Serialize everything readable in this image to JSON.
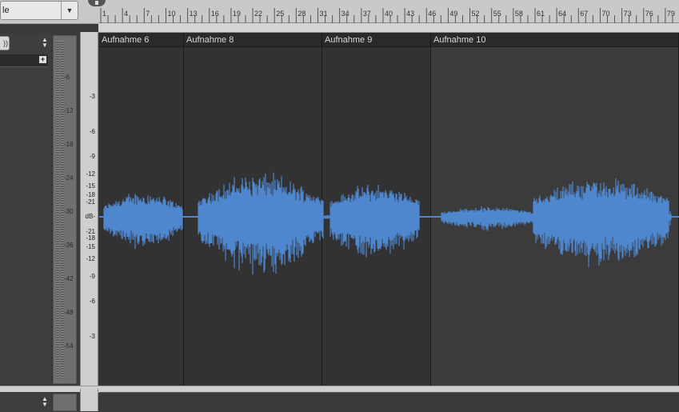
{
  "toolbar": {
    "mode_select_value": "le"
  },
  "ruler": {
    "bars": [
      "1",
      "4",
      "7",
      "10",
      "13",
      "16",
      "19",
      "22",
      "25",
      "28",
      "31",
      "34",
      "37",
      "40",
      "43",
      "46",
      "49",
      "52",
      "55",
      "58",
      "61",
      "64",
      "67",
      "70",
      "73",
      "76",
      "79",
      "8"
    ]
  },
  "meter": {
    "scale": [
      "-6",
      "-12",
      "-18",
      "-24",
      "-30",
      "-36",
      "-42",
      "-48",
      "-54"
    ]
  },
  "db_scale": {
    "labels": [
      "-3",
      "-6",
      "-9",
      "-12",
      "-15",
      "-18",
      "-21",
      "dB-",
      "-21",
      "-18",
      "-15",
      "-12",
      "-9",
      "-6",
      "-3"
    ]
  },
  "clips": [
    {
      "title": "Aufnahme 6"
    },
    {
      "title": "Aufnahme 8"
    },
    {
      "title": "Aufnahme 9"
    },
    {
      "title": "Aufnahme 10"
    }
  ],
  "colors": {
    "waveform": "#4f87cf",
    "clip_bg": "#323232",
    "ruler_bg": "#c9c9c9"
  },
  "icons": {
    "mode_dropdown": "chevron-down-icon",
    "monitor": "speaker-wave-icon",
    "track_order": "up-down-arrows-icon",
    "add": "plus-icon"
  }
}
